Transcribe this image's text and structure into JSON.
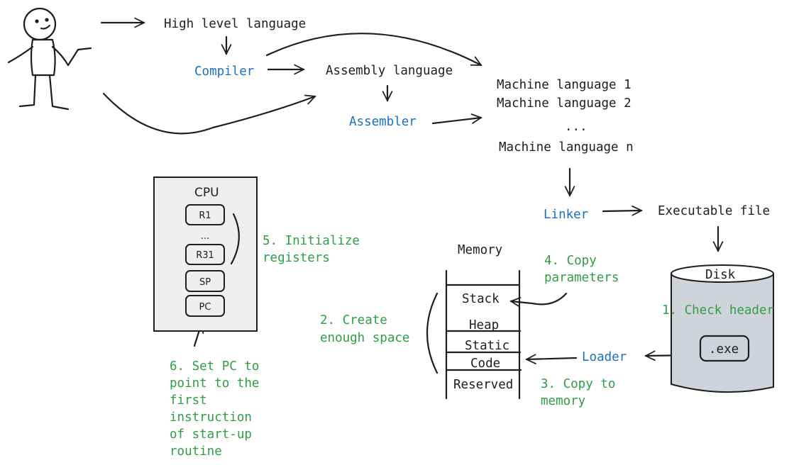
{
  "colors": {
    "stroke": "#1e1e1e",
    "tool_label": "#1971c2",
    "step_label": "#2f9e44",
    "cpu_fill": "#efefef",
    "disk_fill": "#ced4da"
  },
  "pipeline": {
    "high_level": "High level language",
    "compiler": "Compiler",
    "assembly": "Assembly language",
    "assembler": "Assembler",
    "machine": [
      "Machine language 1",
      "Machine language 2",
      "...",
      "Machine language n"
    ],
    "linker": "Linker",
    "executable": "Executable file"
  },
  "disk": {
    "label": "Disk",
    "file": ".exe"
  },
  "loader": "Loader",
  "memory": {
    "title": "Memory",
    "segments": [
      "Stack",
      "Heap",
      "Static",
      "Code",
      "Reserved"
    ]
  },
  "cpu": {
    "title": "CPU",
    "registers": [
      "R1",
      "...",
      "R31",
      "SP",
      "PC"
    ]
  },
  "steps": {
    "s1": [
      "1. Check header"
    ],
    "s2": [
      "2. Create",
      "enough space"
    ],
    "s3": [
      "3. Copy to",
      "memory"
    ],
    "s4": [
      "4. Copy",
      "parameters"
    ],
    "s5": [
      "5. Initialize",
      "registers"
    ],
    "s6": [
      "6. Set PC to",
      "point to the",
      "first",
      "instruction",
      "of start-up",
      "routine"
    ]
  }
}
